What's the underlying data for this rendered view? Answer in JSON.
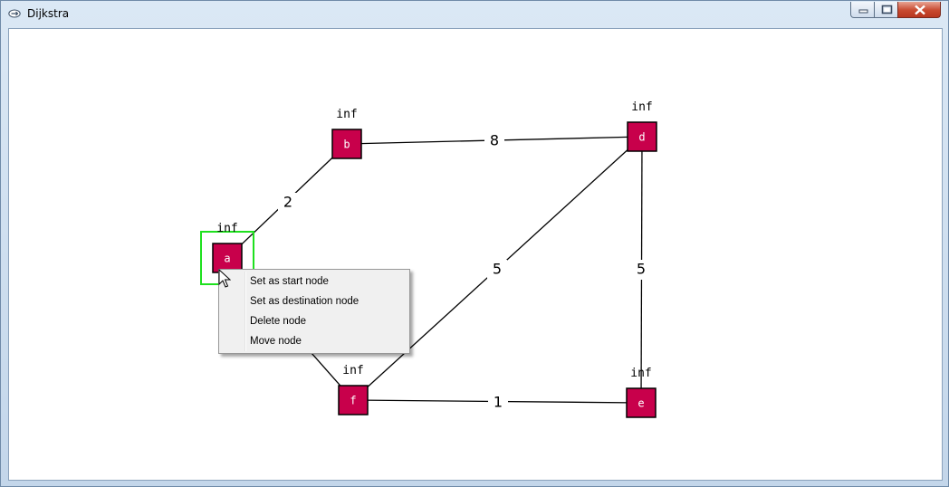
{
  "window": {
    "title": "Dijkstra",
    "icons": {
      "app": "app-icon",
      "minimize": "minimize-icon",
      "maximize": "maximize-icon",
      "close": "close-icon"
    }
  },
  "graph": {
    "nodes": [
      {
        "id": "a",
        "label": "a",
        "dist": "inf",
        "selected": true
      },
      {
        "id": "b",
        "label": "b",
        "dist": "inf"
      },
      {
        "id": "d",
        "label": "d",
        "dist": "inf"
      },
      {
        "id": "f",
        "label": "f",
        "dist": "inf"
      },
      {
        "id": "e",
        "label": "e",
        "dist": "inf"
      }
    ],
    "edges": [
      {
        "from": "a",
        "to": "b",
        "weight": "2"
      },
      {
        "from": "b",
        "to": "d",
        "weight": "8"
      },
      {
        "from": "f",
        "to": "d",
        "weight": "5"
      },
      {
        "from": "d",
        "to": "e",
        "weight": "5"
      },
      {
        "from": "f",
        "to": "e",
        "weight": "1"
      },
      {
        "from": "a",
        "to": "f",
        "weight": ""
      }
    ],
    "colors": {
      "node_fill": "#c8004b",
      "selection": "#1ee01e",
      "edge": "#000000"
    }
  },
  "context_menu": {
    "items": [
      {
        "label": "Set as start node"
      },
      {
        "label": "Set as destination node"
      },
      {
        "label": "Delete node"
      },
      {
        "label": "Move node"
      }
    ]
  }
}
